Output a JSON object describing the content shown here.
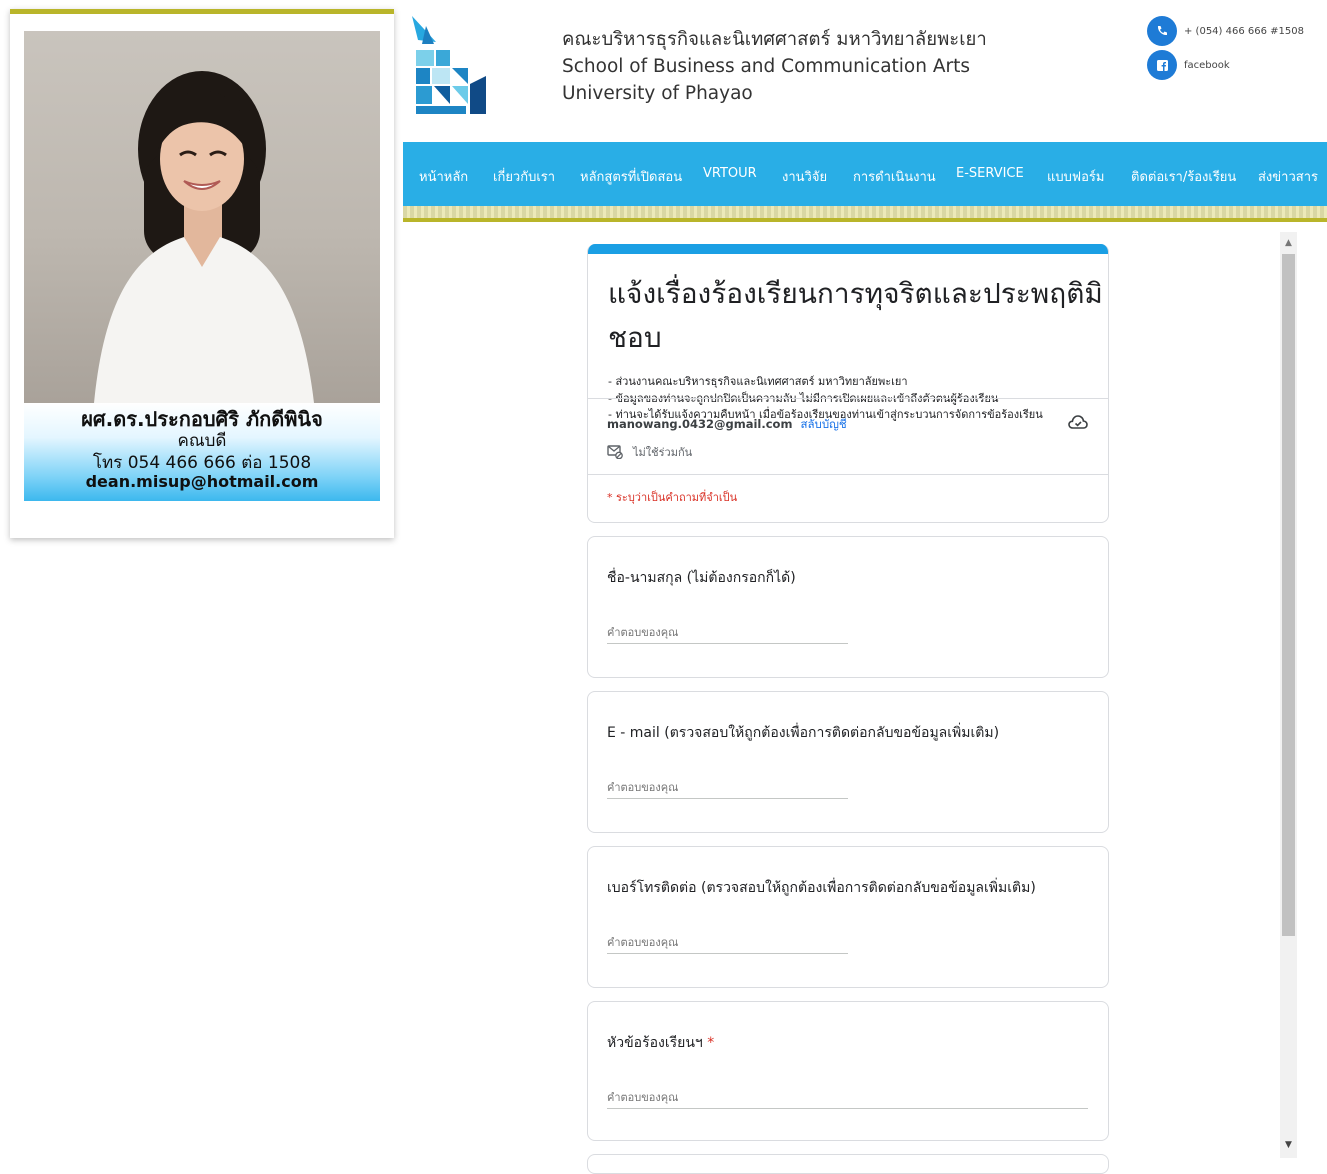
{
  "profile": {
    "name": "ผศ.ดร.ประกอบศิริ ภักดีพินิจ",
    "role": "คณบดี",
    "tel": "โทร 054 466 666 ต่อ 1508",
    "email": "dean.misup@hotmail.com"
  },
  "header": {
    "school_th": "คณะบริหารธุรกิจและนิเทศศาสตร์ มหาวิทยาลัยพะเยา",
    "school_en": "School of Business and Communication Arts",
    "university": "University of Phayao",
    "phone": "+ (054) 466 666 #1508",
    "phone_icon": "phone-icon",
    "facebook": "facebook",
    "facebook_icon": "facebook-icon"
  },
  "nav": {
    "items": [
      {
        "label": "หน้าหลัก"
      },
      {
        "label": "เกี่ยวกับเรา"
      },
      {
        "label": "หลักสูตรที่เปิดสอน"
      },
      {
        "label": "VRTOUR"
      },
      {
        "label": "งานวิจัย"
      },
      {
        "label": "การดำเนินงาน"
      },
      {
        "label": "E-SERVICE"
      },
      {
        "label": "แบบฟอร์ม"
      },
      {
        "label": "ติดต่อเรา/ร้องเรียน"
      },
      {
        "label": "ส่งข่าวสาร"
      }
    ]
  },
  "form": {
    "title": "แจ้งเรื่องร้องเรียนการทุจริตและประพฤติมิชอบ",
    "desc": [
      "- ส่วนงานคณะบริหารธุรกิจและนิเทศศาสตร์ มหาวิทยาลัยพะเยา",
      "- ข้อมูลของท่านจะถูกปกปิดเป็นความลับ ไม่มีการเปิดเผยและเข้าถึงตัวตนผู้ร้องเรียน",
      "- ท่านจะได้รับแจ้งความคืบหน้า เมื่อข้อร้องเรียนของท่านเข้าสู่กระบวนการจัดการข้อร้องเรียน"
    ],
    "account_email": "manowang.0432@gmail.com",
    "switch_account": "สลับบัญชี",
    "not_shared": "ไม่ใช้ร่วมกัน",
    "required_note": "* ระบุว่าเป็นคำถามที่จำเป็น",
    "answer_placeholder": "คำตอบของคุณ",
    "questions": [
      {
        "label": "ชื่อ-นามสกุล (ไม่ต้องกรอกก็ได้)",
        "required": ""
      },
      {
        "label": "E - mail  (ตรวจสอบให้ถูกต้องเพื่อการติดต่อกลับขอข้อมูลเพิ่มเติม)",
        "required": ""
      },
      {
        "label": "เบอร์โทรติดต่อ  (ตรวจสอบให้ถูกต้องเพื่อการติดต่อกลับขอข้อมูลเพิ่มเติม)",
        "required": ""
      },
      {
        "label": "หัวข้อร้องเรียนฯ ",
        "required": "*"
      }
    ]
  },
  "colors": {
    "nav_bg": "#29aee6",
    "accent_olive": "#b9b52a",
    "form_accent": "#1a9fe4",
    "link": "#1a73e8",
    "required": "#d93025"
  }
}
